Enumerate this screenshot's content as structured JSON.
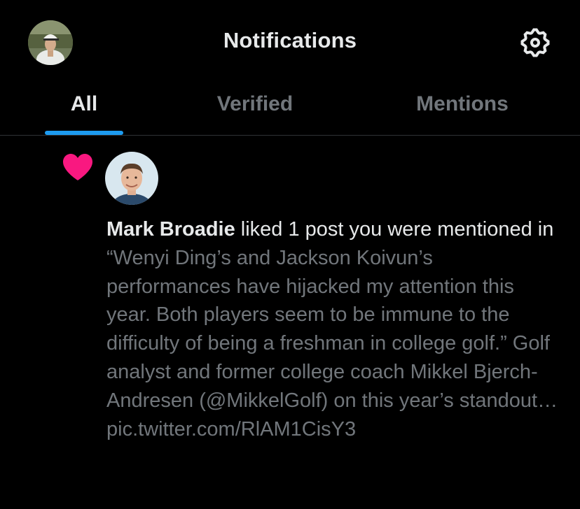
{
  "header": {
    "title": "Notifications",
    "profile_icon": "user-avatar",
    "settings_icon": "gear-icon"
  },
  "tabs": [
    {
      "label": "All",
      "active": true
    },
    {
      "label": "Verified",
      "active": false
    },
    {
      "label": "Mentions",
      "active": false
    }
  ],
  "colors": {
    "background": "#000000",
    "text_primary": "#e7e9ea",
    "text_secondary": "#71767b",
    "accent": "#1d9bf0",
    "like": "#f91880",
    "divider": "#2f3336"
  },
  "notification": {
    "type_icon": "heart-icon",
    "actor_name": "Mark Broadie",
    "action_text": " liked 1 post you were mentioned in",
    "post_text": "“Wenyi Ding’s and Jackson Koivun’s performances have hijacked my attention this year. Both players seem to be immune to the difficulty of being a freshman in college golf.” Golf analyst and former college coach Mikkel Bjerch-Andresen (@MikkelGolf) on this year’s standout… pic.twitter.com/RlAM1CisY3"
  }
}
